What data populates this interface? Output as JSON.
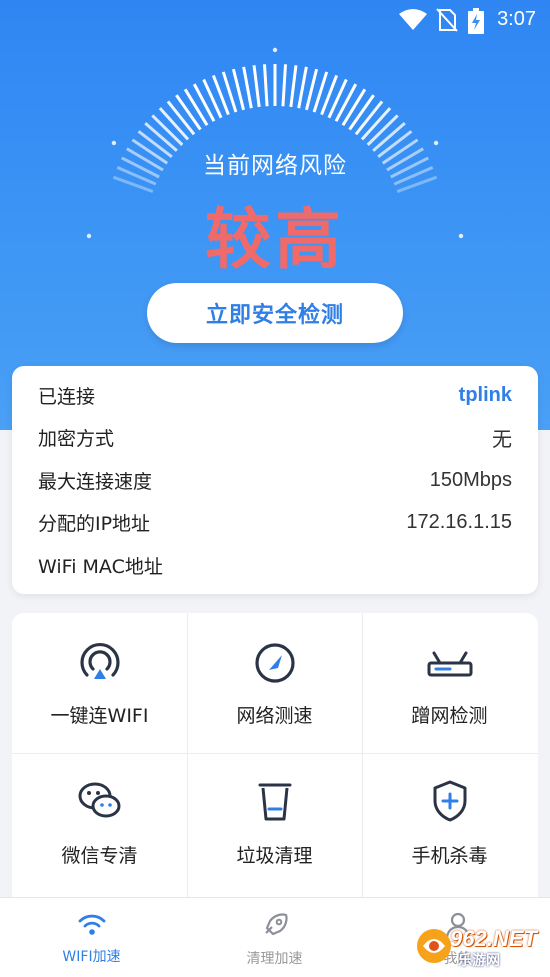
{
  "status_bar": {
    "time": "3:07",
    "icons": [
      "wifi-icon",
      "no-sim-icon",
      "battery-charging-icon"
    ]
  },
  "hero": {
    "risk_label": "当前网络风险",
    "risk_level": "较高",
    "scan_button": "立即安全检测",
    "colors": {
      "background": "#2f86f3",
      "risk": "#ef6a6a",
      "button_text": "#2f7fe6"
    }
  },
  "network_info": [
    {
      "label": "已连接",
      "value": "tplink"
    },
    {
      "label": "加密方式",
      "value": "无"
    },
    {
      "label": "最大连接速度",
      "value": "150Mbps"
    },
    {
      "label": "分配的IP地址",
      "value": "172.16.1.15"
    },
    {
      "label": "WiFi MAC地址",
      "value": ""
    }
  ],
  "tools": [
    {
      "label": "一键连WIFI",
      "icon": "wifi-connect-icon"
    },
    {
      "label": "网络测速",
      "icon": "speedometer-icon"
    },
    {
      "label": "蹭网检测",
      "icon": "router-icon"
    },
    {
      "label": "微信专清",
      "icon": "wechat-icon"
    },
    {
      "label": "垃圾清理",
      "icon": "trash-icon"
    },
    {
      "label": "手机杀毒",
      "icon": "shield-plus-icon"
    }
  ],
  "tabbar": [
    {
      "label": "WIFI加速",
      "icon": "wifi-icon",
      "active": true
    },
    {
      "label": "清理加速",
      "icon": "rocket-icon",
      "active": false
    },
    {
      "label": "我的",
      "icon": "user-icon",
      "active": false
    }
  ],
  "watermark": {
    "brand": "962.NET",
    "sub": "乐游网"
  }
}
